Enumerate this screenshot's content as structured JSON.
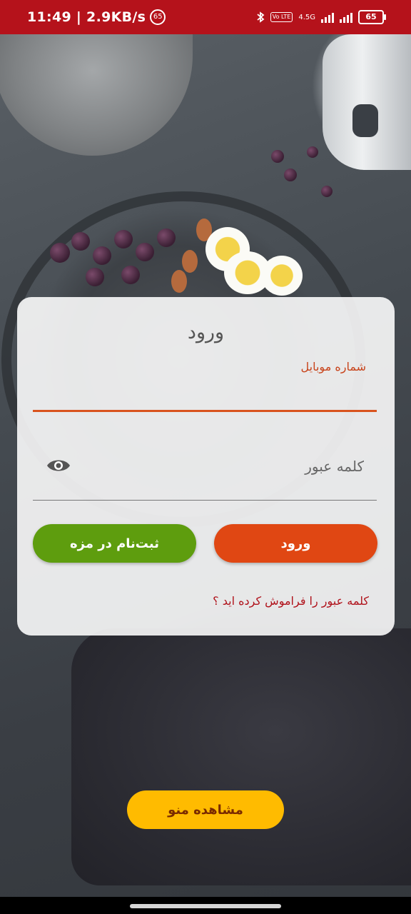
{
  "status_bar": {
    "time": "11:49 | 2.9KB/s",
    "notification_badge": "65",
    "network_label": "4.5G",
    "volte_label": "Vo LTE",
    "battery": "65"
  },
  "login_card": {
    "title": "ورود",
    "mobile_label": "شماره موبایل",
    "mobile_value": "",
    "password_placeholder": "کلمه عبور",
    "login_button": "ورود",
    "signup_button": "ثبت‌نام در مزه",
    "forgot_password": "کلمه عبور را فراموش کرده اید ؟"
  },
  "view_menu_button": "مشاهده منو",
  "colors": {
    "status_bar": "#b5121b",
    "login_button": "#e04713",
    "signup_button": "#5e9d0e",
    "menu_button": "#ffbb00",
    "accent_underline": "#d9531e"
  },
  "icons": [
    "bluetooth-icon",
    "volte-icon",
    "signal-icon",
    "battery-icon",
    "eye-icon"
  ]
}
